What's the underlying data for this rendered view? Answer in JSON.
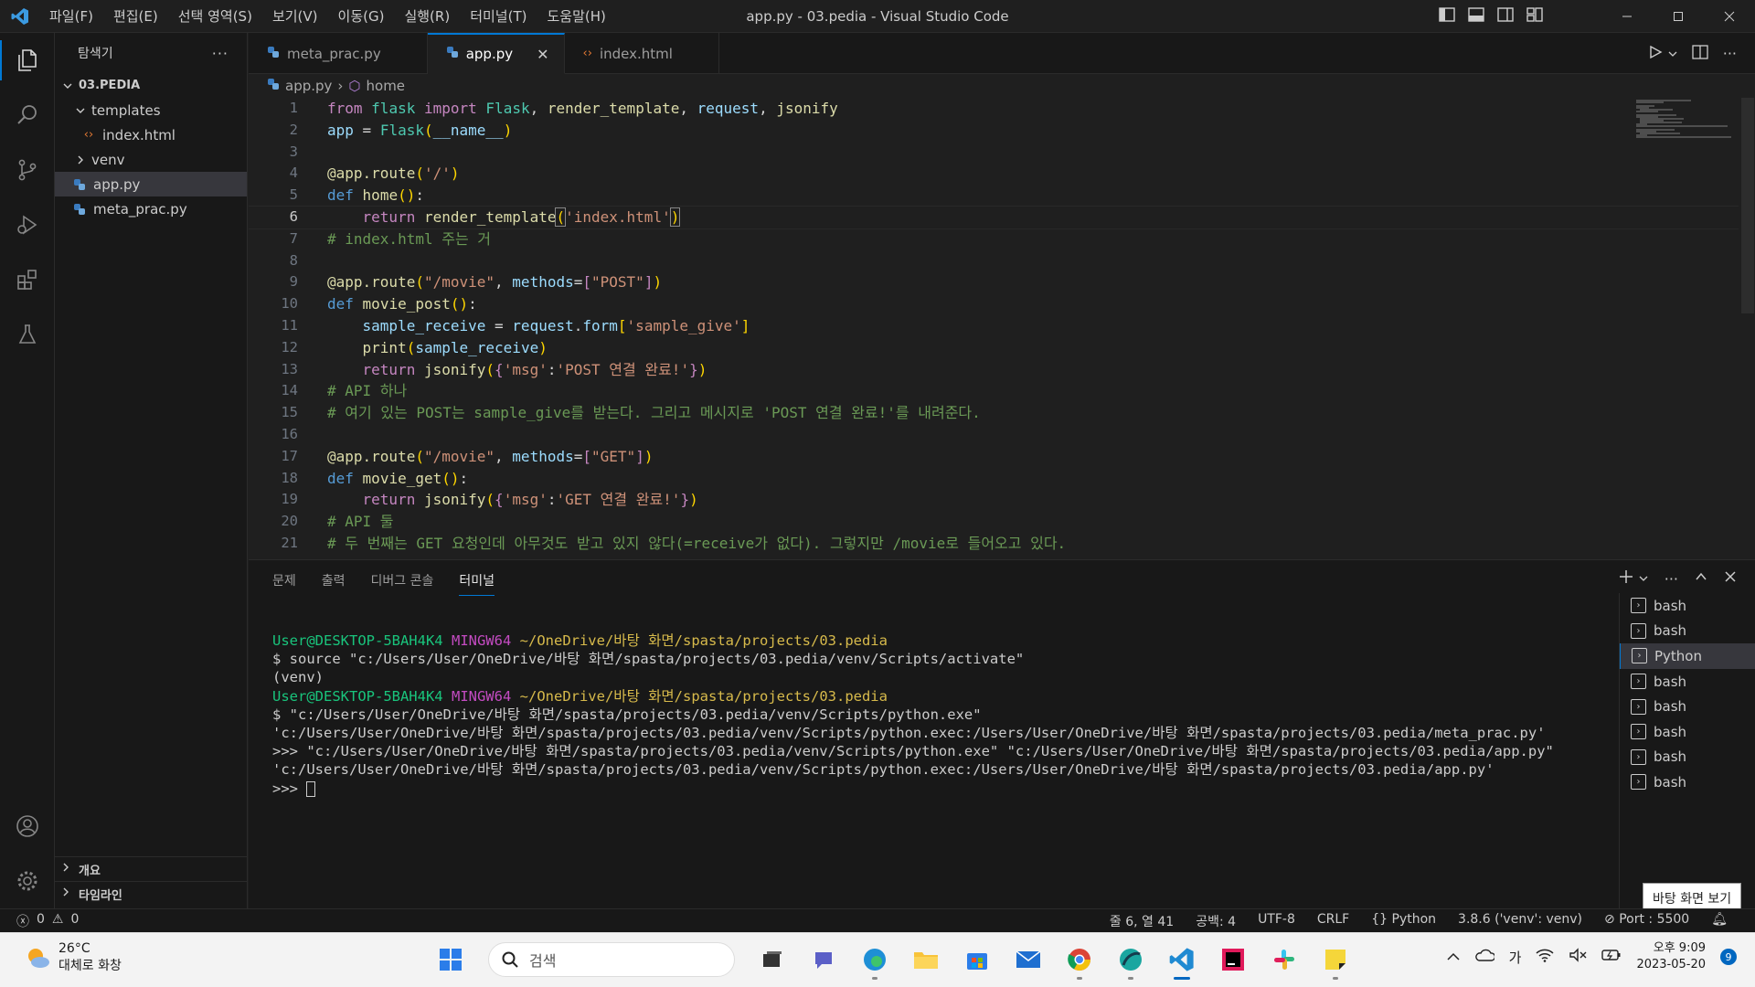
{
  "titlebar": {
    "menu": [
      "파일(F)",
      "편집(E)",
      "선택 영역(S)",
      "보기(V)",
      "이동(G)",
      "실행(R)",
      "터미널(T)",
      "도움말(H)"
    ],
    "title": "app.py - 03.pedia - Visual Studio Code"
  },
  "sidebar": {
    "header": "탐색기",
    "root": "03.PEDIA",
    "items": [
      "templates",
      "index.html",
      "venv",
      "app.py",
      "meta_prac.py"
    ],
    "outline": "개요",
    "timeline": "타임라인"
  },
  "tabs": [
    "meta_prac.py",
    "app.py",
    "index.html"
  ],
  "breadcrumb": {
    "file": "app.py",
    "symbol": "home"
  },
  "editor": {
    "current_line": 6,
    "lines": [
      "1",
      "2",
      "3",
      "4",
      "5",
      "6",
      "7",
      "8",
      "9",
      "10",
      "11",
      "12",
      "13",
      "14",
      "15",
      "16",
      "17",
      "18",
      "19",
      "20",
      "21"
    ],
    "comments": {
      "l7": "# index.html 주는 거",
      "l14": "# API 하나",
      "l15": "# 여기 있는 POST는 sample_give를 받는다. 그리고 메시지로 'POST 연결 완료!'를 내려준다.",
      "l20": "# API 둘",
      "l21": "# 두 번째는 GET 요청인데 아무것도 받고 있지 않다(=receive가 없다). 그렇지만 /movie로 들어오고 있다."
    }
  },
  "panel": {
    "tabs": [
      "문제",
      "출력",
      "디버그 콘솔",
      "터미널"
    ],
    "active_tab": "터미널",
    "terminal": {
      "user": "User@DESKTOP-5BAH4K4",
      "mingw": "MINGW64",
      "path": "~/OneDrive/바탕 화면/spasta/projects/03.pedia",
      "line2": "$ source \"c:/Users/User/OneDrive/바탕 화면/spasta/projects/03.pedia/venv/Scripts/activate\"",
      "line3": "(venv)",
      "line5": "$ \"c:/Users/User/OneDrive/바탕 화면/spasta/projects/03.pedia/venv/Scripts/python.exe\"",
      "line6": "'c:/Users/User/OneDrive/바탕 화면/spasta/projects/03.pedia/venv/Scripts/python.exec:/Users/User/OneDrive/바탕 화면/spasta/projects/03.pedia/meta_prac.py'",
      "line7": ">>> \"c:/Users/User/OneDrive/바탕 화면/spasta/projects/03.pedia/venv/Scripts/python.exe\" \"c:/Users/User/OneDrive/바탕 화면/spasta/projects/03.pedia/app.py\"",
      "line8": "'c:/Users/User/OneDrive/바탕 화면/spasta/projects/03.pedia/venv/Scripts/python.exec:/Users/User/OneDrive/바탕 화면/spasta/projects/03.pedia/app.py'",
      "prompt": ">>> "
    },
    "terminal_list": [
      "bash",
      "bash",
      "Python",
      "bash",
      "bash",
      "bash",
      "bash",
      "bash"
    ],
    "active_terminal_index": 2
  },
  "statusbar": {
    "errors": "0",
    "warnings": "0",
    "position": "줄 6, 열 41",
    "spaces": "공백: 4",
    "encoding": "UTF-8",
    "eol": "CRLF",
    "language": "Python",
    "interpreter": "3.8.6 ('venv': venv)",
    "port": "Port : 5500"
  },
  "tooltip": "바탕 화면 보기",
  "taskbar": {
    "temperature": "26°C",
    "weather": "대체로 화창",
    "search_placeholder": "검색",
    "ime": "가",
    "time": "오후 9:09",
    "date": "2023-05-20",
    "notifications": "9"
  },
  "colors": {
    "accent": "#0078d4",
    "editor_bg": "#1f1f1f",
    "taskbar_bg": "#f3f3f3"
  }
}
